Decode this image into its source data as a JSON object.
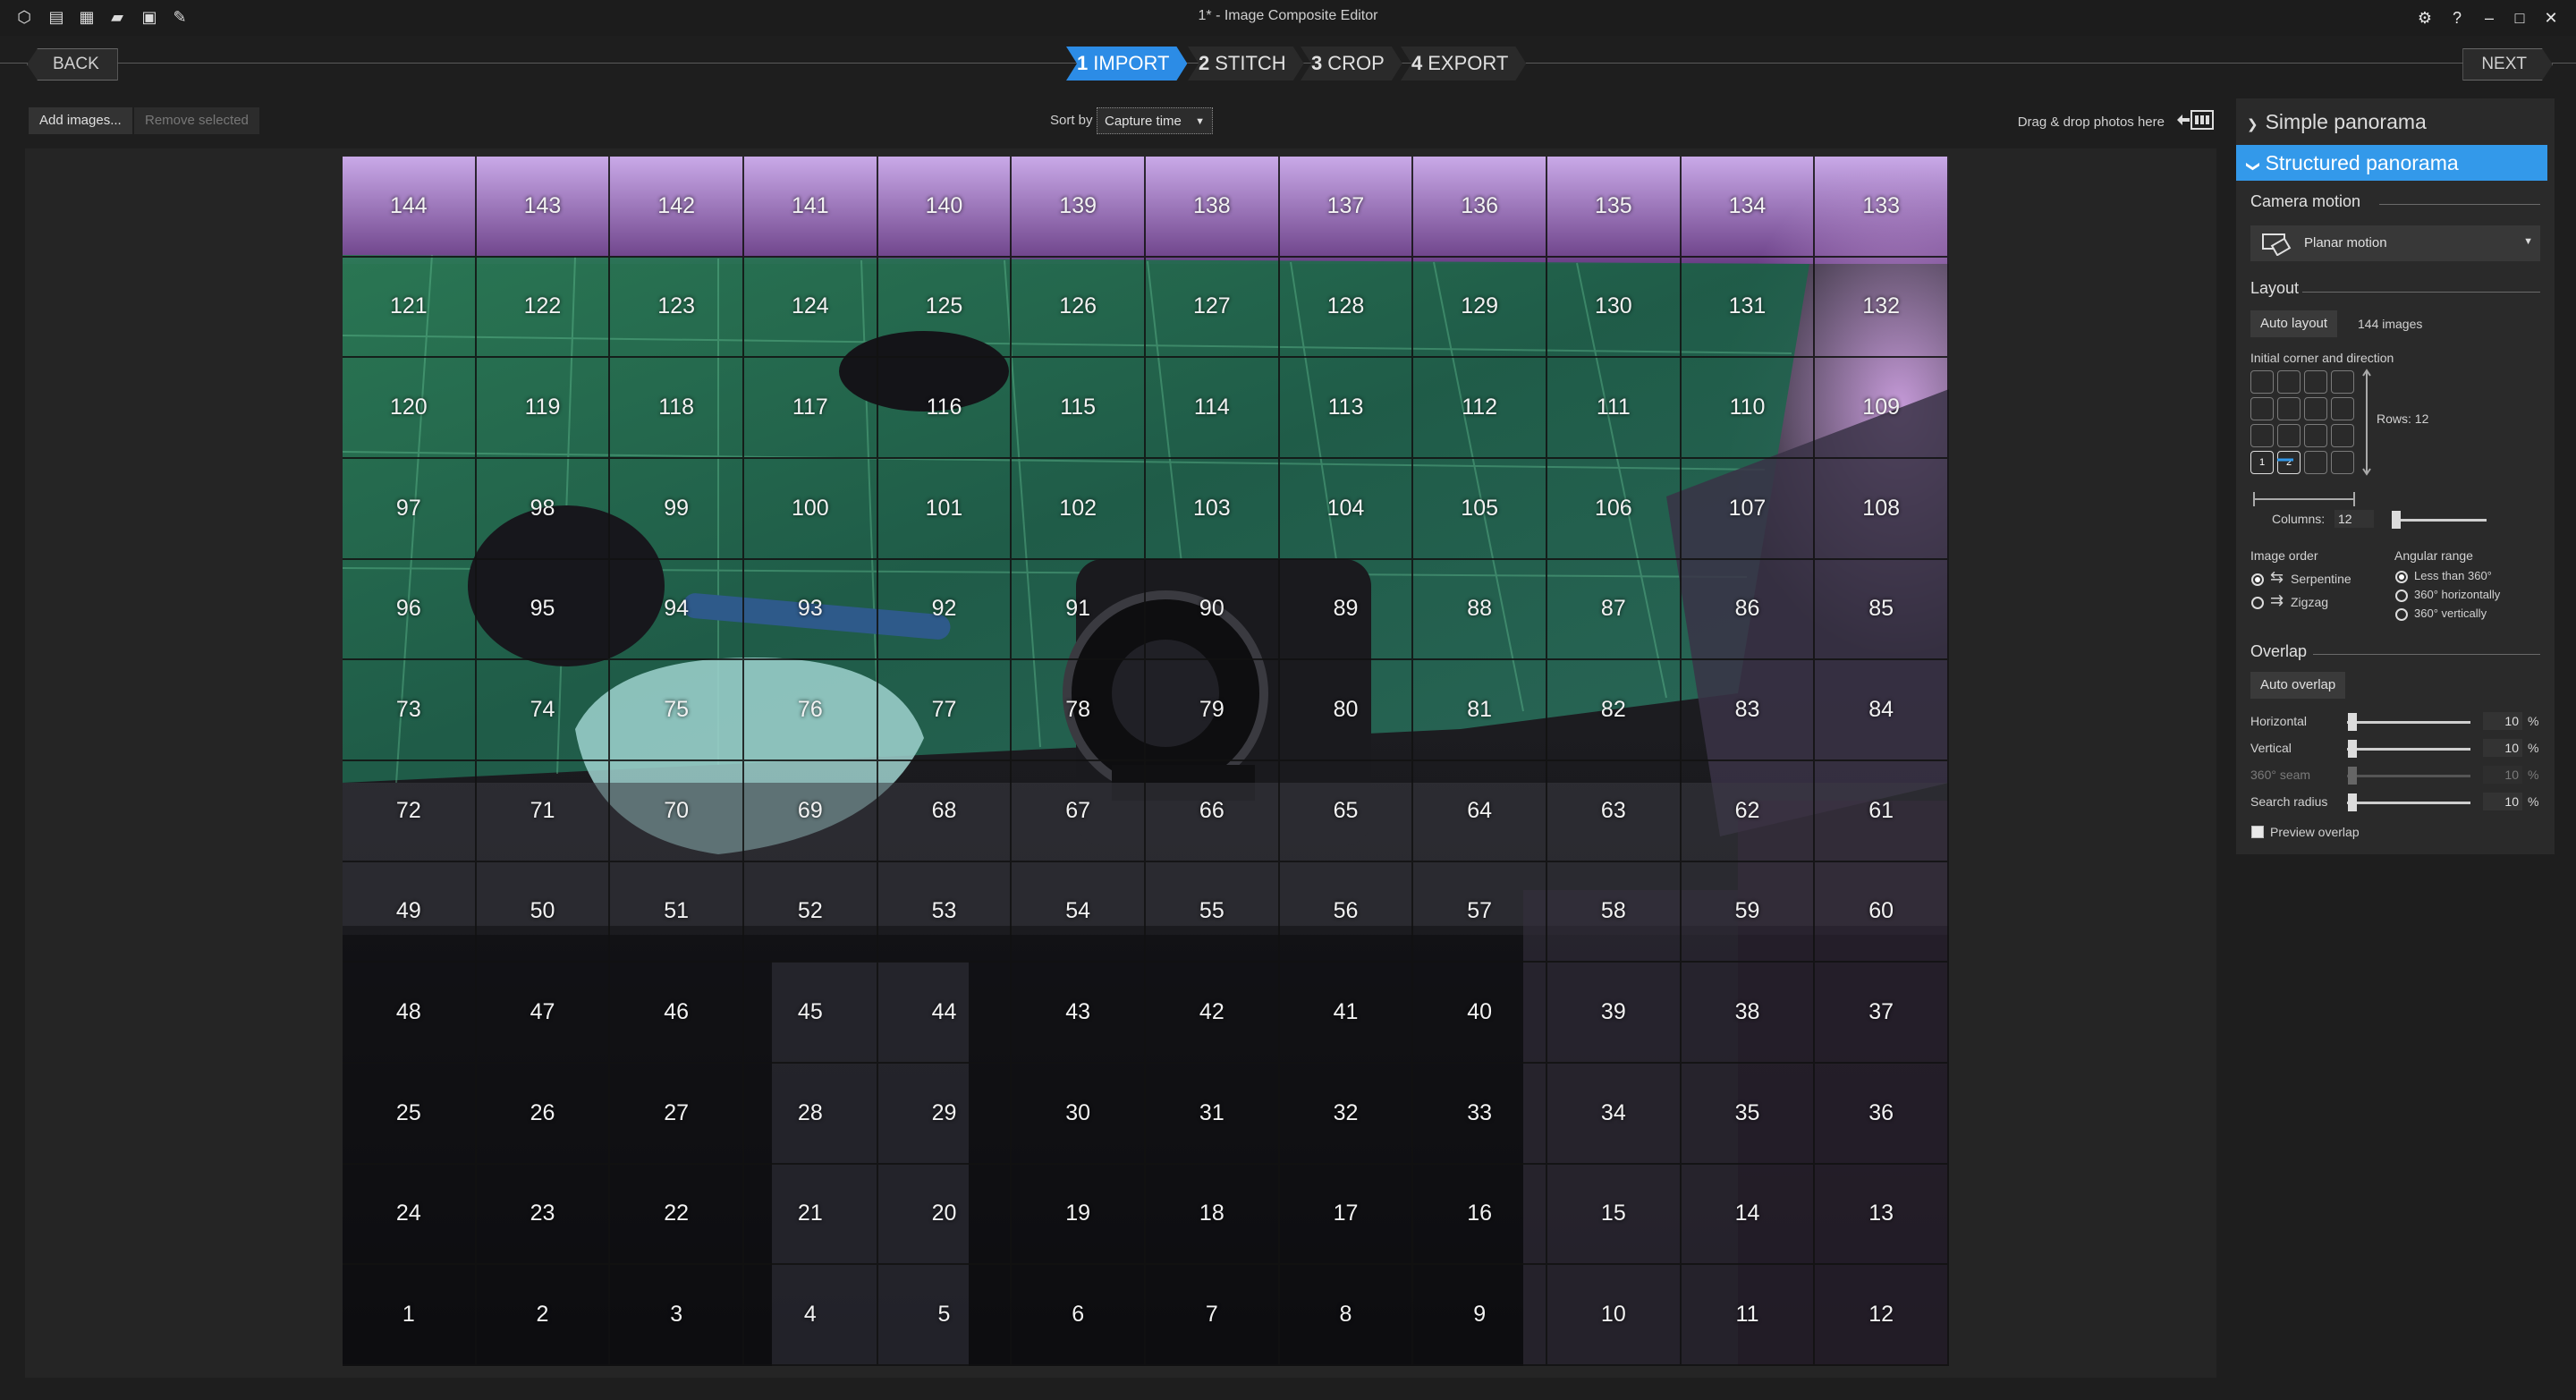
{
  "window": {
    "title": "1* - Image Composite Editor",
    "quick_access_icons": [
      "app-cube-icon",
      "new-project-icon",
      "new-from-images-icon",
      "open-folder-icon",
      "save-icon",
      "save-as-icon"
    ],
    "right_icons": [
      "settings-gear-icon",
      "help-icon",
      "minimize-icon",
      "maximize-icon",
      "close-icon"
    ]
  },
  "wizard": {
    "back_label": "BACK",
    "next_label": "NEXT",
    "steps": [
      {
        "num": "1",
        "label": "IMPORT",
        "active": true
      },
      {
        "num": "2",
        "label": "STITCH",
        "active": false
      },
      {
        "num": "3",
        "label": "CROP",
        "active": false
      },
      {
        "num": "4",
        "label": "EXPORT",
        "active": false
      }
    ]
  },
  "toolbar": {
    "add_images": "Add images...",
    "remove_selected": "Remove selected",
    "sort_by_label": "Sort by",
    "sort_by_value": "Capture time",
    "drag_drop_hint": "Drag & drop photos here"
  },
  "mosaic": {
    "rows": [
      [
        144,
        143,
        142,
        141,
        140,
        139,
        138,
        137,
        136,
        135,
        134,
        133
      ],
      [
        121,
        122,
        123,
        124,
        125,
        126,
        127,
        128,
        129,
        130,
        131,
        132
      ],
      [
        120,
        119,
        118,
        117,
        116,
        115,
        114,
        113,
        112,
        111,
        110,
        109
      ],
      [
        97,
        98,
        99,
        100,
        101,
        102,
        103,
        104,
        105,
        106,
        107,
        108
      ],
      [
        96,
        95,
        94,
        93,
        92,
        91,
        90,
        89,
        88,
        87,
        86,
        85
      ],
      [
        73,
        74,
        75,
        76,
        77,
        78,
        79,
        80,
        81,
        82,
        83,
        84
      ],
      [
        72,
        71,
        70,
        69,
        68,
        67,
        66,
        65,
        64,
        63,
        62,
        61
      ],
      [
        49,
        50,
        51,
        52,
        53,
        54,
        55,
        56,
        57,
        58,
        59,
        60
      ],
      [
        48,
        47,
        46,
        45,
        44,
        43,
        42,
        41,
        40,
        39,
        38,
        37
      ],
      [
        25,
        26,
        27,
        28,
        29,
        30,
        31,
        32,
        33,
        34,
        35,
        36
      ],
      [
        24,
        23,
        22,
        21,
        20,
        19,
        18,
        17,
        16,
        15,
        14,
        13
      ],
      [
        1,
        2,
        3,
        4,
        5,
        6,
        7,
        8,
        9,
        10,
        11,
        12
      ]
    ]
  },
  "panel": {
    "simple_panorama": "Simple panorama",
    "structured_panorama": "Structured panorama",
    "camera_motion": {
      "title": "Camera motion",
      "value": "Planar motion"
    },
    "layout": {
      "title": "Layout",
      "auto_layout": "Auto layout",
      "image_count": "144 images",
      "initial_corner_label": "Initial corner and direction",
      "corner_start_labels": [
        "1",
        "2"
      ],
      "rows_label": "Rows:",
      "rows_value": "12",
      "columns_label": "Columns:",
      "columns_value": "12"
    },
    "image_order": {
      "title": "Image order",
      "options": [
        {
          "label": "Serpentine",
          "selected": true
        },
        {
          "label": "Zigzag",
          "selected": false
        }
      ]
    },
    "angular_range": {
      "title": "Angular range",
      "options": [
        {
          "label": "Less than 360°",
          "selected": true
        },
        {
          "label": "360° horizontally",
          "selected": false
        },
        {
          "label": "360° vertically",
          "selected": false
        }
      ]
    },
    "overlap": {
      "title": "Overlap",
      "auto_overlap": "Auto overlap",
      "sliders": [
        {
          "label": "Horizontal",
          "value": "10",
          "unit": "%",
          "enabled": true
        },
        {
          "label": "Vertical",
          "value": "10",
          "unit": "%",
          "enabled": true
        },
        {
          "label": "360° seam",
          "value": "10",
          "unit": "%",
          "enabled": false
        },
        {
          "label": "Search radius",
          "value": "10",
          "unit": "%",
          "enabled": true
        }
      ],
      "preview_overlap": "Preview overlap"
    }
  },
  "colors": {
    "accent": "#2c8ce6",
    "panel_active": "#3399ea",
    "background": "#1e1e1e"
  }
}
